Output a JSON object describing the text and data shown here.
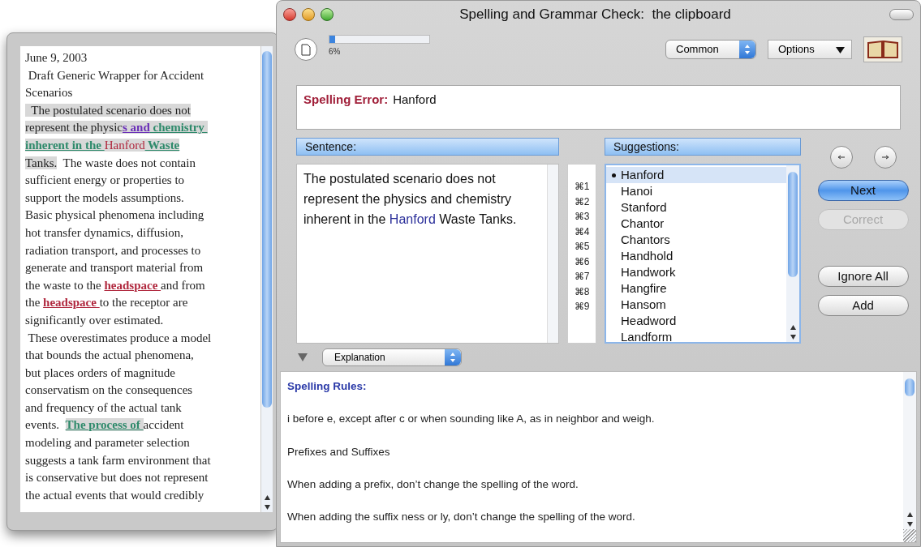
{
  "document": {
    "lines": [
      [
        {
          "text": "June 9, 2003",
          "kind": "plain"
        }
      ],
      [
        {
          "text": " Draft Generic Wrapper for Accident",
          "kind": "plain"
        }
      ],
      [
        {
          "text": "Scenarios",
          "kind": "plain"
        }
      ],
      [
        {
          "text": "  The postulated scenario does not",
          "kind": "selected"
        }
      ],
      [
        {
          "text": "represent the physic",
          "kind": "selected"
        },
        {
          "text": "s and",
          "kind": "grammar"
        },
        {
          "text": " chemistry ",
          "kind": "style"
        }
      ],
      [
        {
          "text": "inherent in the ",
          "kind": "style"
        },
        {
          "text": "Hanford",
          "kind": "misspelled"
        },
        {
          "text": " Waste",
          "kind": "style"
        }
      ],
      [
        {
          "text": "Tanks.",
          "kind": "selected"
        },
        {
          "text": "  The waste does not contain",
          "kind": "plain"
        }
      ],
      [
        {
          "text": "sufficient energy or properties to",
          "kind": "plain"
        }
      ],
      [
        {
          "text": "support the models assumptions.",
          "kind": "plain"
        }
      ],
      [
        {
          "text": "Basic physical phenomena including",
          "kind": "plain"
        }
      ],
      [
        {
          "text": "hot transfer dynamics, diffusion,",
          "kind": "plain"
        }
      ],
      [
        {
          "text": "radiation transport, and processes to",
          "kind": "plain"
        }
      ],
      [
        {
          "text": "generate and transport material from",
          "kind": "plain"
        }
      ],
      [
        {
          "text": "the waste to the ",
          "kind": "plain"
        },
        {
          "text": "headspace ",
          "kind": "flagged"
        },
        {
          "text": "and from",
          "kind": "plain"
        }
      ],
      [
        {
          "text": "the ",
          "kind": "plain"
        },
        {
          "text": "headspace ",
          "kind": "flagged"
        },
        {
          "text": "to the receptor are",
          "kind": "plain"
        }
      ],
      [
        {
          "text": "significantly over estimated.",
          "kind": "plain"
        }
      ],
      [
        {
          "text": " These overestimates produce a model",
          "kind": "plain"
        }
      ],
      [
        {
          "text": "that bounds the actual phenomena,",
          "kind": "plain"
        }
      ],
      [
        {
          "text": "but places orders of magnitude",
          "kind": "plain"
        }
      ],
      [
        {
          "text": "conservatism on the consequences",
          "kind": "plain"
        }
      ],
      [
        {
          "text": "and frequency of the actual tank",
          "kind": "plain"
        }
      ],
      [
        {
          "text": "events.  ",
          "kind": "plain"
        },
        {
          "text": "The process of ",
          "kind": "style"
        },
        {
          "text": "accident",
          "kind": "plain"
        }
      ],
      [
        {
          "text": "modeling and parameter selection",
          "kind": "plain"
        }
      ],
      [
        {
          "text": "suggests a tank farm environment that",
          "kind": "plain"
        }
      ],
      [
        {
          "text": "is conservative but does not represent",
          "kind": "plain"
        }
      ],
      [
        {
          "text": "the actual events that would credibly",
          "kind": "plain"
        }
      ]
    ]
  },
  "window": {
    "title": "Spelling and Grammar Check:  the clipboard"
  },
  "progress": {
    "level": 0.06,
    "reading": "6%"
  },
  "dictionary_popup": "Common",
  "options_menu": "Options",
  "error": {
    "label": "Spelling Error:",
    "word": "Hanford"
  },
  "sentence": {
    "header": "Sentence:",
    "before": "The postulated scenario does not represent the physics and chemistry inherent in the ",
    "flagged": "Hanford",
    "after": " Waste Tanks."
  },
  "shortcuts": [
    "⌘1",
    "⌘2",
    "⌘3",
    "⌘4",
    "⌘5",
    "⌘6",
    "⌘7",
    "⌘8",
    "⌘9"
  ],
  "suggestions": {
    "header": "Suggestions:",
    "items": [
      {
        "label": "Hanford",
        "selected": true
      },
      {
        "label": "Hanoi",
        "selected": false
      },
      {
        "label": "Stanford",
        "selected": false
      },
      {
        "label": "Chantor",
        "selected": false
      },
      {
        "label": "Chantors",
        "selected": false
      },
      {
        "label": "Handhold",
        "selected": false
      },
      {
        "label": "Handwork",
        "selected": false
      },
      {
        "label": "Hangfire",
        "selected": false
      },
      {
        "label": "Hansom",
        "selected": false
      },
      {
        "label": "Headword",
        "selected": false
      },
      {
        "label": "Landform",
        "selected": false
      }
    ]
  },
  "buttons": [
    {
      "label": "Next",
      "kind": "default",
      "disabled": false
    },
    {
      "label": "Correct",
      "kind": "plain",
      "disabled": true
    },
    {
      "label": "Ignore All",
      "kind": "plain",
      "disabled": false
    },
    {
      "label": "Add",
      "kind": "plain",
      "disabled": false
    }
  ],
  "explanation": {
    "popup": "Explanation",
    "expanded": true,
    "heading": "Spelling Rules:",
    "paragraphs": [
      "i before e, except after c or when sounding like A, as in neighbor and weigh.",
      "Prefixes and Suffixes",
      "When adding a prefix, don’t change the spelling of the word.",
      "When adding the suffix ness or ly, don’t change the spelling of the word."
    ]
  }
}
